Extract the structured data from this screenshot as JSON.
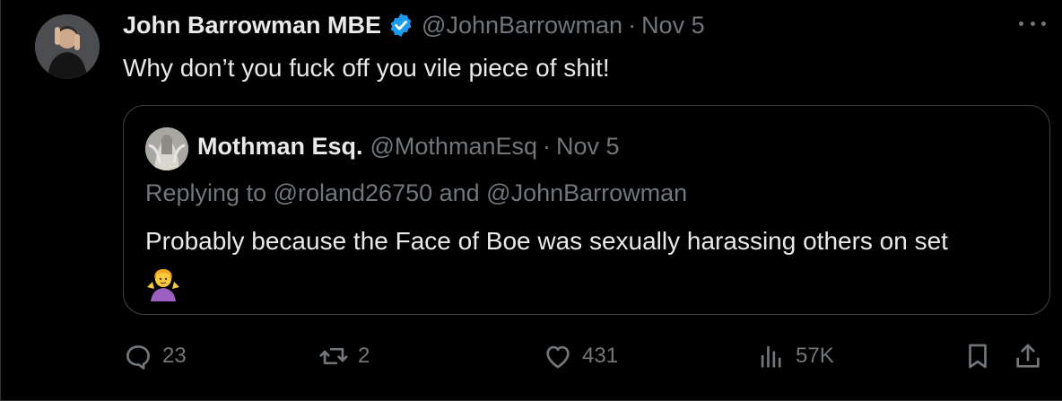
{
  "tweet": {
    "author_name": "John Barrowman MBE",
    "author_handle": "@JohnBarrowman",
    "separator": "·",
    "date": "Nov 5",
    "text": "Why don’t you fuck off you vile piece of shit!",
    "verified_color": "#1d9bf0"
  },
  "quoted": {
    "author_name": "Mothman Esq.",
    "author_handle": "@MothmanEsq",
    "separator": "·",
    "date": "Nov 5",
    "replying_to": "Replying to @roland26750 and @JohnBarrowman",
    "text": "Probably because the Face of Boe was sexually harassing others on set",
    "emoji": "person-shrugging-emoji"
  },
  "actions": {
    "replies": "23",
    "reposts": "2",
    "likes": "431",
    "views": "57K"
  },
  "icons": [
    "more-icon",
    "verified-badge-icon",
    "reply-icon",
    "repost-icon",
    "like-icon",
    "views-icon",
    "bookmark-icon",
    "share-icon"
  ]
}
